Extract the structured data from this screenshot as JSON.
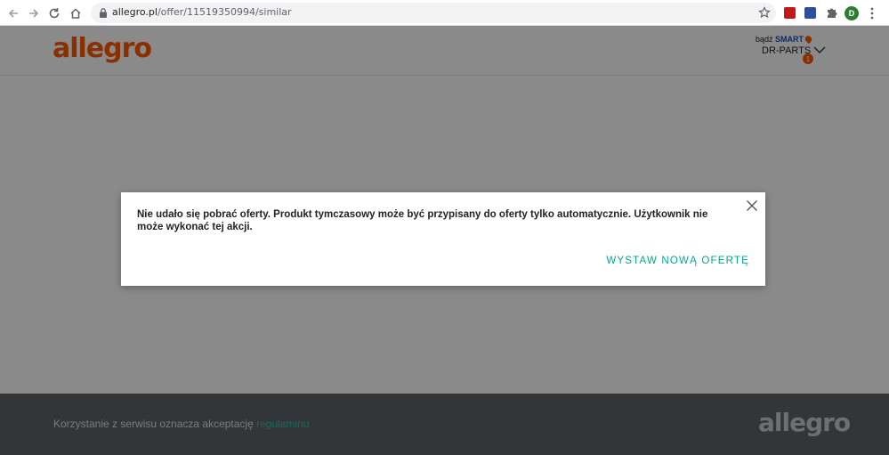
{
  "browser": {
    "url_host": "allegro.pl",
    "url_path": "/offer/11519350994/similar",
    "profile_initial": "D"
  },
  "header": {
    "logo": "allegro",
    "smart_prefix": "bądź",
    "smart_label": "SMART",
    "account_name": "DR-PARTS",
    "account_badge": "1"
  },
  "modal": {
    "message": "Nie udało się pobrać oferty. Produkt tymczasowy może być przypisany do oferty tylko automatycznie. Użytkownik nie może wykonać tej akcji.",
    "action_label": "WYSTAW NOWĄ OFERTĘ"
  },
  "footer": {
    "text": "Korzystanie z serwisu oznacza akceptację",
    "link": "regulaminu",
    "logo": "allegro"
  },
  "colors": {
    "brand_orange": "#ff5a00",
    "accent_teal": "#00a790",
    "footer_bg": "#5d6469"
  }
}
